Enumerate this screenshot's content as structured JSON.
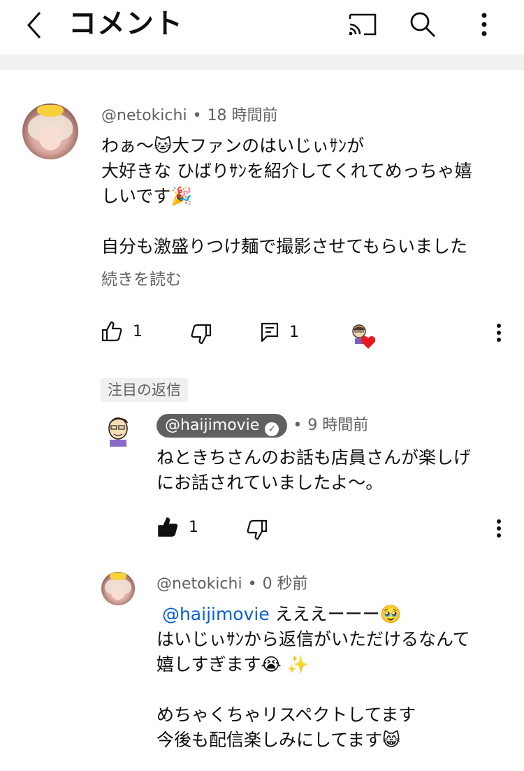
{
  "header": {
    "title": "コメント",
    "icons": [
      "back-icon",
      "cast-icon",
      "search-icon",
      "more-vert-icon"
    ]
  },
  "comment": {
    "author": "@netokichi",
    "time": "18 時間前",
    "lines": [
      "わぁ〜🐱大ファンのはいじぃｻﾝが",
      "大好きな ひばりｻﾝを紹介してくれてめっちゃ嬉",
      "しいです🎉",
      "",
      "自分も激盛りつけ麺で撮影させてもらいました"
    ],
    "read_more": "続きを読む",
    "likes": "1",
    "replies": "1"
  },
  "pinned_label": "注目の返信",
  "reply1": {
    "author": "@haijimovie",
    "verified": "✓",
    "time": "9 時間前",
    "lines": [
      "ねときちさんのお話も店員さんが楽しげ",
      "にお話されていましたよ〜。"
    ],
    "likes": "1"
  },
  "reply2": {
    "author": "@netokichi",
    "time": "0 秒前",
    "mention": "@haijimovie",
    "line1_rest": " えええーーー🥹",
    "lines": [
      "はいじぃｻﾝから返信がいただけるなんて",
      "嬉しすぎます😭 ✨",
      "",
      "めちゃくちゃリスペクトしてます",
      "今後も配信楽しみにしてます😸"
    ]
  },
  "separator": "•"
}
